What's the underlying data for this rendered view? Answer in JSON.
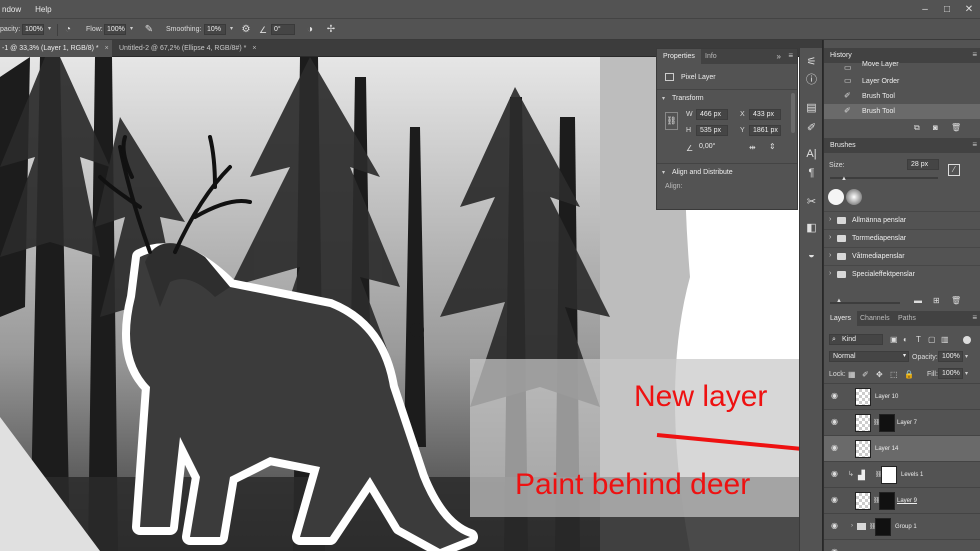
{
  "menu": [
    "ndow",
    "Help"
  ],
  "window_controls": [
    "–",
    "□",
    "✕"
  ],
  "options": {
    "opacity_label": "pacity:",
    "opacity_value": "100%",
    "flow_label": "Flow:",
    "flow_value": "100%",
    "smoothing_label": "Smoothing:",
    "smoothing_value": "10%",
    "angle_value": "0°"
  },
  "tabs": [
    {
      "label": "-1 @ 33,3% (Layer 1, RGB/8) *",
      "active": true
    },
    {
      "label": "Untitled-2 @ 67,2% (Ellipse 4, RGB/8#) *",
      "active": false
    }
  ],
  "tab_close": "×",
  "properties": {
    "tabs": [
      "Properties",
      "Info"
    ],
    "collapse_glyph": "»",
    "kind": "Pixel Layer",
    "transform_title": "Transform",
    "w_label": "W",
    "w_value": "466 px",
    "x_label": "X",
    "x_value": "433 px",
    "h_label": "H",
    "h_value": "535 px",
    "y_label": "Y",
    "y_value": "1861 px",
    "angle_value": "0,00°",
    "align_title": "Align and Distribute",
    "align_label": "Align:"
  },
  "history": {
    "title": "History",
    "items": [
      {
        "label": "Move Layer"
      },
      {
        "label": "Layer Order"
      },
      {
        "label": "Brush Tool"
      },
      {
        "label": "Brush Tool",
        "selected": true
      }
    ]
  },
  "brushes": {
    "title": "Brushes",
    "size_label": "Size:",
    "size_value": "28 px",
    "folders": [
      "Allmänna penslar",
      "Torrmediapenslar",
      "Våtmediapenslar",
      "Specialeffektpenslar"
    ]
  },
  "layers_panel": {
    "tabs": [
      "Layers",
      "Channels",
      "Paths"
    ],
    "kind_value": "Kind",
    "blend_mode": "Normal",
    "opacity_label": "Opacity:",
    "opacity_value": "100%",
    "lock_label": "Lock:",
    "fill_label": "Fill:",
    "fill_value": "100%",
    "layers": [
      {
        "name": "Layer 10"
      },
      {
        "name": "Layer 7"
      },
      {
        "name": "Layer 14",
        "selected": true
      },
      {
        "name": "Levels 1"
      },
      {
        "name": "Layer 9"
      },
      {
        "name": "Group 1"
      }
    ]
  },
  "annotations": {
    "new_layer": "New layer",
    "paint_behind": "Paint behind deer"
  },
  "colors": {
    "annotation_red": "#ee1111",
    "panel_bg": "#535353",
    "selection": "#6a6a6a"
  }
}
